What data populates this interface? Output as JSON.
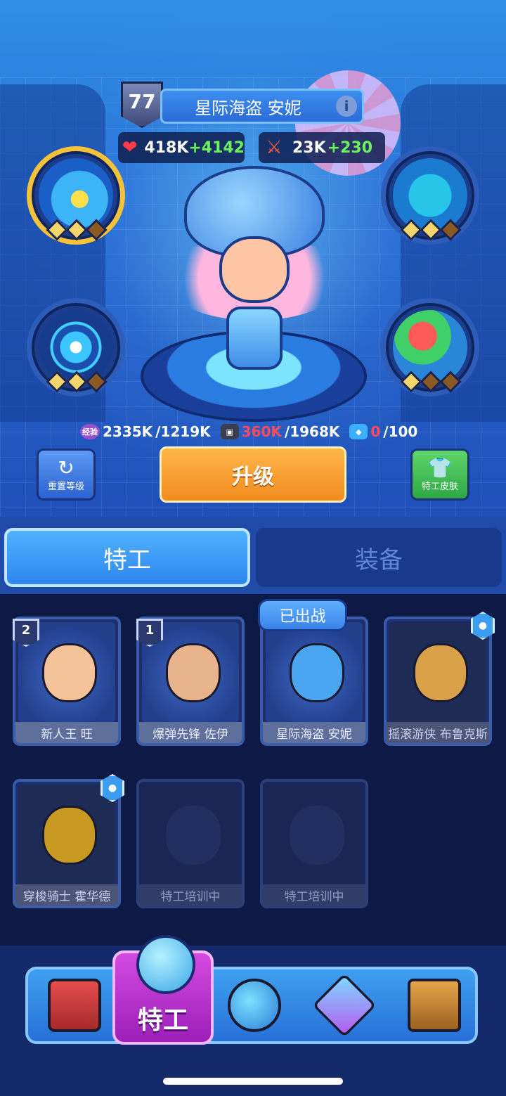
{
  "hero": {
    "level": "77",
    "name": "星际海盗 安妮",
    "info_icon": "i",
    "hp": {
      "base": "418K",
      "bonus": "+4142"
    },
    "attack": {
      "base": "23K",
      "bonus": "+230"
    },
    "skill_stars": [
      {
        "filled": 2,
        "total": 3
      },
      {
        "filled": 2,
        "total": 3
      },
      {
        "filled": 2,
        "total": 3
      },
      {
        "filled": 1,
        "total": 3
      }
    ]
  },
  "resources": {
    "exp_icon_label": "经验",
    "exp_current": "2335K",
    "exp_required": "/1219K",
    "tape_current": "360K",
    "tape_required": "/1968K",
    "card_current": "0",
    "card_required": "/100"
  },
  "actions": {
    "reset_label": "重置等级",
    "upgrade_label": "升级",
    "skin_label": "特工皮肤"
  },
  "tabs": [
    {
      "label": "特工",
      "active": true
    },
    {
      "label": "装备",
      "active": false
    }
  ],
  "deployed_label": "已出战",
  "agents": [
    {
      "name": "新人王 旺",
      "rank": "2",
      "state": "owned"
    },
    {
      "name": "爆弹先锋 佐伊",
      "rank": "1",
      "state": "owned"
    },
    {
      "name": "星际海盗 安妮",
      "rank": "",
      "state": "deployed"
    },
    {
      "name": "摇滚游侠 布鲁克斯",
      "rank": "",
      "state": "locked"
    },
    {
      "name": "穿梭骑士 霍华德",
      "rank": "",
      "state": "locked"
    },
    {
      "name": "特工培训中",
      "rank": "",
      "state": "training"
    },
    {
      "name": "特工培训中",
      "rank": "",
      "state": "training"
    }
  ],
  "bottom_nav": {
    "active_label": "特工"
  },
  "colors": {
    "upgrade_orange": "#f28b1e",
    "bonus_green": "#6cf25a",
    "shortage_red": "#ff4a5a",
    "agent_nav_purple": "#9a1fb8"
  }
}
